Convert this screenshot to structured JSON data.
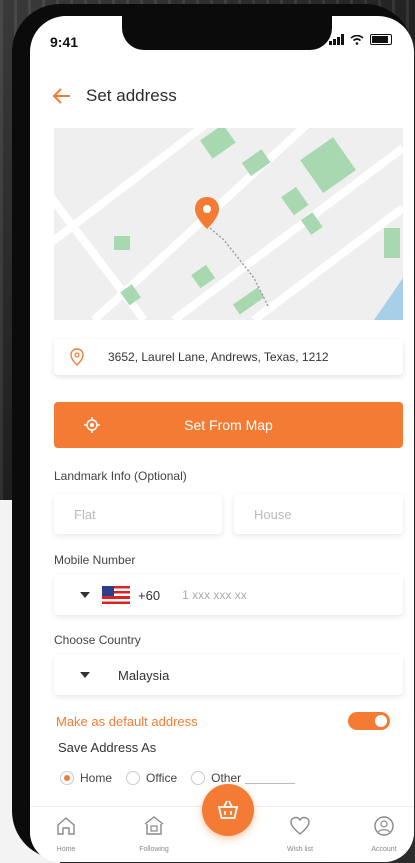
{
  "status": {
    "time": "9:41"
  },
  "header": {
    "title": "Set address"
  },
  "address": {
    "text": "3652,  Laurel Lane, Andrews, Texas, 1212"
  },
  "set_from_map": {
    "label": "Set From Map"
  },
  "landmark": {
    "label": "Landmark Info (Optional)",
    "flat_placeholder": "Flat",
    "house_placeholder": "House"
  },
  "mobile": {
    "label": "Mobile Number",
    "code": "+60",
    "placeholder": "1 xxx xxx xx"
  },
  "country": {
    "label": "Choose Country",
    "value": "Malaysia"
  },
  "default_address": {
    "label": "Make as default address",
    "enabled": true
  },
  "save_as": {
    "label": "Save Address As",
    "options": [
      "Home",
      "Office",
      "Other"
    ],
    "selected": "Home"
  },
  "nav": {
    "items": [
      "Home",
      "Following",
      "Wish list",
      "Account"
    ]
  },
  "colors": {
    "accent": "#f47b33"
  },
  "icons": [
    "back-arrow-icon",
    "location-pin-icon",
    "target-icon",
    "caret-down-icon",
    "flag-icon",
    "home-icon",
    "following-icon",
    "heart-icon",
    "account-icon",
    "cart-icon"
  ]
}
